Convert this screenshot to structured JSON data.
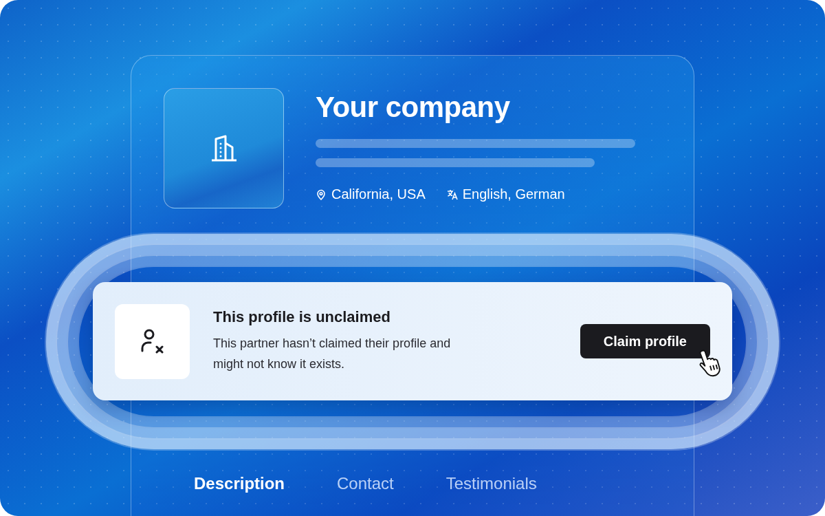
{
  "company": {
    "name": "Your company",
    "location": "California, USA",
    "languages": "English, German"
  },
  "notice": {
    "title": "This profile is unclaimed",
    "message": "This partner hasn’t claimed their profile and might not know it exists.",
    "button": "Claim profile"
  },
  "tabs": [
    {
      "label": "Description",
      "selected": true
    },
    {
      "label": "Contact",
      "selected": false
    },
    {
      "label": "Testimonials",
      "selected": false
    }
  ]
}
